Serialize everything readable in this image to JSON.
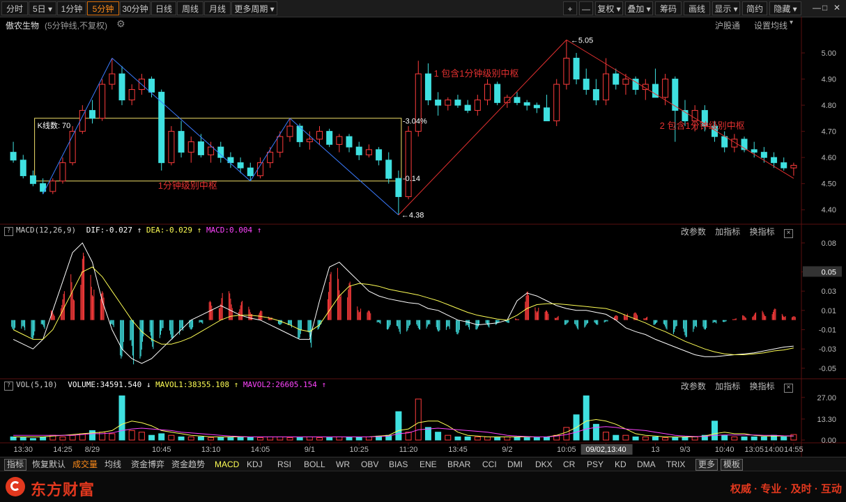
{
  "toolbar": {
    "left": [
      {
        "label": "分时",
        "active": false
      },
      {
        "label": "5日",
        "active": false,
        "dropdown": true
      },
      {
        "label": "1分钟",
        "active": false
      },
      {
        "label": "5分钟",
        "active": true
      },
      {
        "label": "30分钟",
        "active": false
      },
      {
        "label": "日线",
        "active": false
      },
      {
        "label": "周线",
        "active": false
      },
      {
        "label": "月线",
        "active": false
      },
      {
        "label": "更多周期",
        "active": false,
        "dropdown": true
      }
    ],
    "right": [
      {
        "label": "+"
      },
      {
        "label": "—"
      },
      {
        "label": "复权",
        "dropdown": true
      },
      {
        "label": "叠加",
        "dropdown": true
      },
      {
        "label": "筹码"
      },
      {
        "label": "画线"
      },
      {
        "label": "显示",
        "dropdown": true
      },
      {
        "label": "简约"
      },
      {
        "label": "隐藏",
        "dropdown": true
      }
    ]
  },
  "title": {
    "stock": "傲农生物",
    "desc": "(5分钟线,不复权)",
    "right_a": "沪股通",
    "right_b": "设置均线"
  },
  "annotations": {
    "box_label": "K线数: 70",
    "zone1": "1分钟级别中枢",
    "zone2": "1  包含1分钟级别中枢",
    "zone3": "2  包含1分钟级别中枢",
    "top": "5.05",
    "low": "4.38",
    "pct": "3.04%",
    "chg": "0.14"
  },
  "macd_header": {
    "name": "MACD(12,26,9)",
    "dif": "DIF:-0.027",
    "dea": "DEA:-0.029",
    "macd": "MACD:0.004"
  },
  "vol_header": {
    "name": "VOL(5,10)",
    "volume": "VOLUME:34591.540",
    "mavol1": "MAVOL1:38355.108",
    "mavol2": "MAVOL2:26605.154"
  },
  "panel_buttons": {
    "params": "改参数",
    "add": "加指标",
    "swap": "换指标"
  },
  "time_axis": [
    "13:30",
    "14:25",
    "8/29",
    "10:45",
    "13:10",
    "14:05",
    "9/1",
    "10:25",
    "11:20",
    "13:45",
    "9/2",
    "10:05",
    "11:00",
    "13",
    "9/3",
    "10:40",
    "13:05",
    "14:00",
    "14:55"
  ],
  "crosshair_time": "09/02,13:40",
  "bottom_tabs": [
    "指标",
    "恢复默认",
    "成交量",
    "均线",
    "资金博弈",
    "资金趋势",
    "MACD",
    "KDJ",
    "RSI",
    "BOLL",
    "WR",
    "OBV",
    "BIAS",
    "ENE",
    "BRAR",
    "CCI",
    "DMI",
    "DKX",
    "CR",
    "PSY",
    "KD",
    "DMA",
    "TRIX",
    "更多",
    "模板"
  ],
  "footer": {
    "brand": "东方财富",
    "slogan": "权威 · 专业 · 及时 · 互动"
  },
  "colors": {
    "up": "#ff3c3c",
    "down": "#3fe0e0",
    "ma": "#ffffff",
    "ma2": "#ffff55",
    "mavol2": "#ff44ff",
    "accent": "#ff8c1a",
    "bi": "#3a7bff"
  },
  "chart_data": [
    {
      "type": "candlestick",
      "title": "傲农生物 (5分钟线,不复权)",
      "ylim": [
        4.35,
        5.08
      ],
      "yticks": [
        4.4,
        4.5,
        4.6,
        4.7,
        4.8,
        4.9,
        5.0
      ],
      "ohlc": [
        [
          4.62,
          4.66,
          4.58,
          4.59
        ],
        [
          4.59,
          4.61,
          4.52,
          4.53
        ],
        [
          4.53,
          4.55,
          4.49,
          4.5
        ],
        [
          4.5,
          4.52,
          4.46,
          4.47
        ],
        [
          4.47,
          4.52,
          4.46,
          4.51
        ],
        [
          4.51,
          4.6,
          4.5,
          4.58
        ],
        [
          4.58,
          4.72,
          4.57,
          4.7
        ],
        [
          4.7,
          4.8,
          4.69,
          4.78
        ],
        [
          4.78,
          4.82,
          4.73,
          4.75
        ],
        [
          4.75,
          4.9,
          4.74,
          4.88
        ],
        [
          4.88,
          4.98,
          4.86,
          4.92
        ],
        [
          4.92,
          4.95,
          4.8,
          4.82
        ],
        [
          4.82,
          4.88,
          4.8,
          4.86
        ],
        [
          4.86,
          4.92,
          4.84,
          4.9
        ],
        [
          4.9,
          4.91,
          4.83,
          4.85
        ],
        [
          4.85,
          4.86,
          4.55,
          4.58
        ],
        [
          4.58,
          4.72,
          4.57,
          4.7
        ],
        [
          4.7,
          4.74,
          4.6,
          4.62
        ],
        [
          4.62,
          4.68,
          4.58,
          4.66
        ],
        [
          4.66,
          4.69,
          4.6,
          4.61
        ],
        [
          4.61,
          4.66,
          4.58,
          4.64
        ],
        [
          4.64,
          4.66,
          4.58,
          4.6
        ],
        [
          4.6,
          4.62,
          4.56,
          4.58
        ],
        [
          4.58,
          4.6,
          4.54,
          4.56
        ],
        [
          4.56,
          4.58,
          4.51,
          4.53
        ],
        [
          4.53,
          4.6,
          4.52,
          4.58
        ],
        [
          4.58,
          4.64,
          4.56,
          4.62
        ],
        [
          4.62,
          4.7,
          4.6,
          4.68
        ],
        [
          4.68,
          4.75,
          4.66,
          4.72
        ],
        [
          4.72,
          4.73,
          4.64,
          4.66
        ],
        [
          4.66,
          4.7,
          4.63,
          4.67
        ],
        [
          4.67,
          4.72,
          4.65,
          4.7
        ],
        [
          4.7,
          4.71,
          4.64,
          4.65
        ],
        [
          4.65,
          4.69,
          4.62,
          4.68
        ],
        [
          4.68,
          4.69,
          4.62,
          4.64
        ],
        [
          4.64,
          4.66,
          4.59,
          4.61
        ],
        [
          4.61,
          4.65,
          4.6,
          4.63
        ],
        [
          4.63,
          4.64,
          4.57,
          4.59
        ],
        [
          4.59,
          4.62,
          4.5,
          4.52
        ],
        [
          4.52,
          4.55,
          4.38,
          4.45
        ],
        [
          4.45,
          4.72,
          4.44,
          4.7
        ],
        [
          4.7,
          4.97,
          4.68,
          4.92
        ],
        [
          4.92,
          4.96,
          4.8,
          4.82
        ],
        [
          4.82,
          4.85,
          4.76,
          4.8
        ],
        [
          4.8,
          4.83,
          4.78,
          4.82
        ],
        [
          4.82,
          4.84,
          4.79,
          4.8
        ],
        [
          4.8,
          4.82,
          4.77,
          4.78
        ],
        [
          4.78,
          4.84,
          4.76,
          4.82
        ],
        [
          4.82,
          4.9,
          4.8,
          4.88
        ],
        [
          4.88,
          4.89,
          4.8,
          4.81
        ],
        [
          4.81,
          4.84,
          4.79,
          4.83
        ],
        [
          4.83,
          4.85,
          4.8,
          4.81
        ],
        [
          4.81,
          4.82,
          4.78,
          4.8
        ],
        [
          4.8,
          4.81,
          4.77,
          4.79
        ],
        [
          4.79,
          4.84,
          4.76,
          4.74
        ],
        [
          4.74,
          4.9,
          4.72,
          4.88
        ],
        [
          4.88,
          5.05,
          4.86,
          4.98
        ],
        [
          4.98,
          5.0,
          4.88,
          4.9
        ],
        [
          4.9,
          4.94,
          4.84,
          4.86
        ],
        [
          4.86,
          4.9,
          4.8,
          4.82
        ],
        [
          4.82,
          4.98,
          4.8,
          4.92
        ],
        [
          4.92,
          4.94,
          4.86,
          4.88
        ],
        [
          4.88,
          4.92,
          4.84,
          4.9
        ],
        [
          4.9,
          4.91,
          4.84,
          4.86
        ],
        [
          4.86,
          4.9,
          4.82,
          4.88
        ],
        [
          4.88,
          4.94,
          4.85,
          4.83
        ],
        [
          4.83,
          4.92,
          4.8,
          4.9
        ],
        [
          4.9,
          4.91,
          4.66,
          4.78
        ],
        [
          4.78,
          4.82,
          4.72,
          4.74
        ],
        [
          4.74,
          4.8,
          4.7,
          4.78
        ],
        [
          4.78,
          4.8,
          4.7,
          4.72
        ],
        [
          4.72,
          4.74,
          4.66,
          4.68
        ],
        [
          4.68,
          4.7,
          4.62,
          4.64
        ],
        [
          4.64,
          4.69,
          4.62,
          4.67
        ],
        [
          4.67,
          4.68,
          4.62,
          4.63
        ],
        [
          4.63,
          4.66,
          4.6,
          4.62
        ],
        [
          4.62,
          4.64,
          4.58,
          4.6
        ],
        [
          4.6,
          4.62,
          4.56,
          4.58
        ],
        [
          4.58,
          4.6,
          4.55,
          4.56
        ],
        [
          4.56,
          4.58,
          4.53,
          4.57
        ]
      ],
      "bi_lines": [
        [
          4.46,
          4.98
        ],
        [
          4.98,
          4.51
        ],
        [
          4.51,
          4.75
        ],
        [
          4.75,
          4.38
        ],
        [
          4.38,
          5.05
        ],
        [
          5.05,
          4.52
        ]
      ]
    },
    {
      "type": "bar",
      "name": "MACD(12,26,9)",
      "ylim": [
        -0.058,
        0.085
      ],
      "yticks": [
        0.08,
        0.05,
        0.03,
        0.01,
        -0.01,
        -0.03,
        -0.05
      ],
      "hist": [
        -0.01,
        -0.015,
        -0.02,
        -0.01,
        0.01,
        0.03,
        0.05,
        0.07,
        0.06,
        0.03,
        -0.01,
        -0.04,
        -0.05,
        -0.04,
        -0.03,
        -0.02,
        -0.02,
        -0.02,
        -0.01,
        -0.005,
        0.02,
        0.03,
        0.03,
        0.02,
        0.015,
        0.01,
        0.005,
        -0.005,
        -0.01,
        -0.02,
        -0.03,
        -0.01,
        0.05,
        0.06,
        0.04,
        0.02,
        0.01,
        -0.005,
        -0.01,
        -0.015,
        -0.012,
        -0.01,
        -0.01,
        -0.012,
        -0.015,
        -0.015,
        -0.012,
        -0.01,
        -0.008,
        -0.005,
        -0.003,
        0.002,
        0.03,
        0.02,
        0.01,
        0.005,
        -0.005,
        -0.01,
        -0.008,
        -0.005,
        -0.003,
        0.005,
        0.01,
        0.008,
        0.004,
        -0.005,
        -0.01,
        -0.015,
        -0.018,
        -0.015,
        -0.01,
        -0.005,
        -0.002,
        0.002,
        0.005,
        0.008,
        0.01,
        0.012,
        0.008,
        0.004
      ],
      "dif": [
        -0.02,
        -0.025,
        -0.03,
        -0.02,
        0.01,
        0.04,
        0.07,
        0.08,
        0.06,
        0.02,
        -0.01,
        -0.03,
        -0.04,
        -0.045,
        -0.04,
        -0.03,
        -0.02,
        -0.01,
        0.0,
        0.005,
        0.01,
        0.015,
        0.01,
        0.005,
        0.002,
        0.0,
        -0.005,
        -0.01,
        -0.015,
        -0.02,
        -0.02,
        0.02,
        0.055,
        0.06,
        0.05,
        0.04,
        0.03,
        0.025,
        0.022,
        0.02,
        0.018,
        0.017,
        0.012,
        0.01,
        0.005,
        0.0,
        -0.002,
        -0.005,
        -0.004,
        -0.003,
        0.0,
        0.02,
        0.028,
        0.025,
        0.02,
        0.015,
        0.012,
        0.01,
        0.01,
        0.008,
        0.006,
        0.0,
        -0.008,
        -0.012,
        -0.015,
        -0.02,
        -0.024,
        -0.028,
        -0.032,
        -0.036,
        -0.038,
        -0.038,
        -0.037,
        -0.036,
        -0.035,
        -0.034,
        -0.032,
        -0.03,
        -0.028,
        -0.027
      ],
      "dea": [
        -0.01,
        -0.015,
        -0.02,
        -0.02,
        -0.01,
        0.01,
        0.03,
        0.05,
        0.055,
        0.045,
        0.03,
        0.015,
        0.0,
        -0.012,
        -0.02,
        -0.025,
        -0.025,
        -0.022,
        -0.018,
        -0.012,
        -0.006,
        0.0,
        0.004,
        0.005,
        0.005,
        0.004,
        0.002,
        -0.001,
        -0.005,
        -0.01,
        -0.012,
        -0.005,
        0.01,
        0.025,
        0.035,
        0.038,
        0.037,
        0.035,
        0.032,
        0.03,
        0.028,
        0.026,
        0.023,
        0.02,
        0.016,
        0.012,
        0.008,
        0.005,
        0.003,
        0.001,
        0.0,
        0.005,
        0.012,
        0.016,
        0.017,
        0.017,
        0.016,
        0.015,
        0.014,
        0.013,
        0.012,
        0.009,
        0.005,
        0.001,
        -0.003,
        -0.008,
        -0.012,
        -0.017,
        -0.022,
        -0.026,
        -0.03,
        -0.033,
        -0.035,
        -0.036,
        -0.036,
        -0.035,
        -0.034,
        -0.032,
        -0.031,
        -0.029
      ]
    },
    {
      "type": "bar",
      "name": "VOL(5,10)",
      "ylim": [
        0,
        30
      ],
      "yticks": [
        27.0,
        13.3,
        0.0
      ],
      "volume": [
        2,
        1.5,
        1,
        2,
        3,
        2,
        3,
        4,
        6,
        5,
        4,
        28,
        6,
        5,
        3,
        4,
        3,
        2,
        2,
        2,
        1.5,
        1.5,
        1.5,
        2,
        2,
        1.5,
        2,
        2,
        1.5,
        1.5,
        2,
        1.5,
        1.5,
        2,
        2,
        2,
        2,
        2.5,
        3,
        18,
        5,
        26,
        8,
        5,
        3,
        2,
        2,
        2,
        2,
        1.5,
        2,
        2,
        1.5,
        1.5,
        2,
        3,
        8,
        16,
        28,
        10,
        5,
        3,
        3,
        2,
        2,
        2,
        1.5,
        1.5,
        2,
        2,
        3,
        12,
        3,
        2,
        2,
        2,
        2,
        3,
        2,
        3.5
      ],
      "mavol1": [
        2,
        2,
        2,
        2,
        2.5,
        3,
        3.5,
        4,
        4.5,
        5,
        6,
        10,
        12,
        11,
        9,
        6,
        5,
        4,
        3,
        2.5,
        2,
        2,
        2,
        2,
        2,
        2,
        2,
        2,
        2,
        2,
        2,
        2,
        2,
        2,
        2,
        2,
        2,
        2.5,
        3,
        6,
        7,
        11,
        12,
        12,
        9,
        5,
        3,
        2.5,
        2,
        2,
        2,
        2,
        2,
        2,
        2,
        3,
        5,
        8,
        12,
        13,
        12,
        10,
        7,
        4,
        3,
        2.5,
        2,
        2,
        2,
        2,
        2.5,
        4,
        5,
        4,
        4,
        3,
        2.5,
        2.5,
        2.5,
        2.5
      ],
      "mavol2": [
        3,
        3,
        3,
        3,
        3,
        3,
        3,
        3.5,
        4,
        4,
        4.5,
        6,
        7,
        7.5,
        7,
        6.5,
        6,
        5,
        4.5,
        4,
        3.5,
        3,
        2.5,
        2.2,
        2,
        2,
        2,
        2,
        2,
        2,
        2,
        2,
        2,
        2,
        2,
        2,
        2,
        2.2,
        2.5,
        4,
        4.5,
        6.5,
        7,
        7.5,
        7,
        6.5,
        6,
        5.5,
        5,
        4,
        3,
        2.5,
        2.2,
        2,
        2,
        2.5,
        3.5,
        5,
        7,
        8,
        8.5,
        8,
        7,
        6.5,
        6,
        5,
        4,
        3,
        2.5,
        2.2,
        2.3,
        3,
        3.2,
        3.2,
        3.2,
        3.2,
        3,
        3,
        2.7,
        2.6
      ]
    }
  ]
}
